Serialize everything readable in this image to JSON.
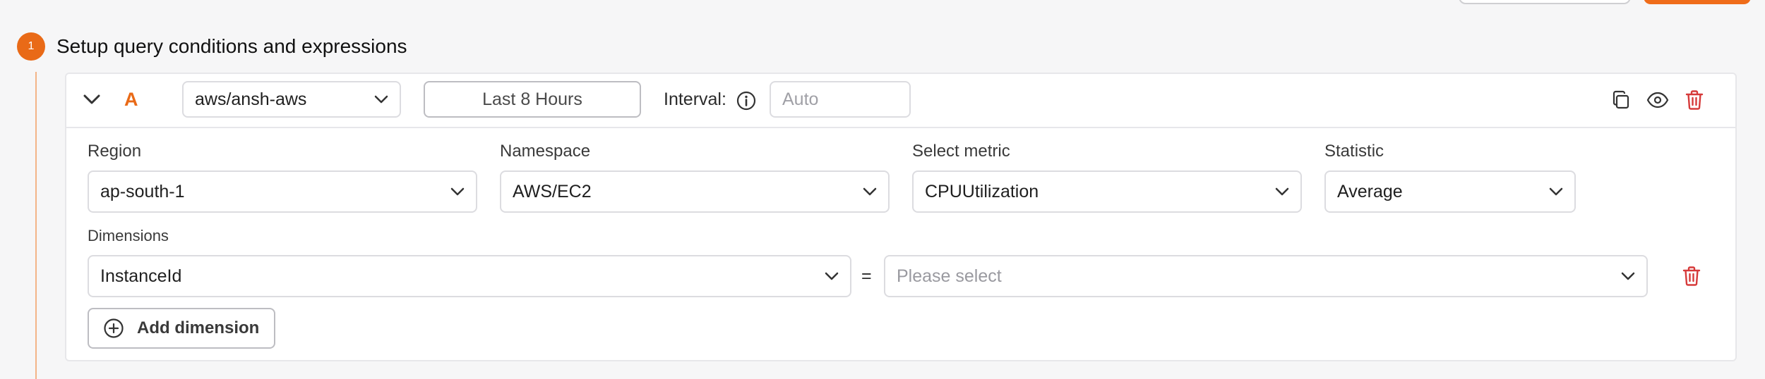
{
  "step": {
    "number": "1",
    "title": "Setup query conditions and expressions"
  },
  "query": {
    "letter": "A",
    "datasource": "aws/ansh-aws",
    "time_range": "Last 8 Hours",
    "interval_label": "Interval:",
    "interval_placeholder": "Auto"
  },
  "fields": {
    "region": {
      "label": "Region",
      "value": "ap-south-1"
    },
    "namespace": {
      "label": "Namespace",
      "value": "AWS/EC2"
    },
    "metric": {
      "label": "Select metric",
      "value": "CPUUtilization"
    },
    "statistic": {
      "label": "Statistic",
      "value": "Average"
    }
  },
  "dimensions": {
    "label": "Dimensions",
    "key": "InstanceId",
    "operator": "=",
    "value_placeholder": "Please select",
    "add_label": "Add dimension"
  },
  "icons": {
    "collapse": "chevron-down-icon",
    "info": "info-icon",
    "copy": "copy-icon",
    "view": "eye-icon",
    "delete": "trash-icon",
    "add": "plus-circle-icon"
  },
  "colors": {
    "accent": "#e96a17",
    "danger": "#d63a3a",
    "border": "#dcdce0"
  }
}
